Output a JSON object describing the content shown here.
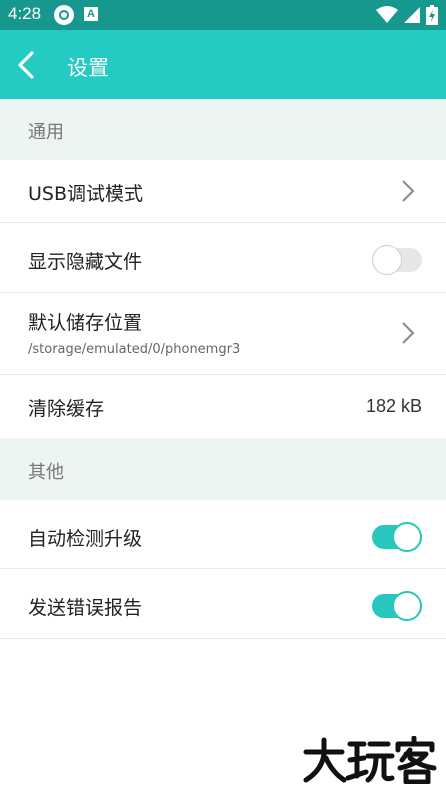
{
  "status_bar": {
    "time": "4:28",
    "icons": [
      "app-notification-icon",
      "a-notification-icon",
      "wifi-icon",
      "cell-signal-icon",
      "battery-icon"
    ]
  },
  "toolbar": {
    "back_icon": "chevron-left-icon",
    "title": "设置"
  },
  "sections": {
    "general": {
      "header": "通用",
      "usb_debug": {
        "label": "USB调试模式"
      },
      "show_hidden": {
        "label": "显示隐藏文件",
        "enabled": false
      },
      "storage_location": {
        "label": "默认储存位置",
        "path": "/storage/emulated/0/phonemgr3"
      },
      "clear_cache": {
        "label": "清除缓存",
        "value": "182 kB"
      }
    },
    "other": {
      "header": "其他",
      "auto_update": {
        "label": "自动检测升级",
        "enabled": true
      },
      "send_reports": {
        "label": "发送错误报告",
        "enabled": true
      }
    }
  },
  "watermark": {
    "text": "大玩客"
  },
  "colors": {
    "status_bar": "#17988f",
    "toolbar": "#23cbc3",
    "toggle_on": "#27c7bd",
    "section_bg": "#edf4f4"
  }
}
